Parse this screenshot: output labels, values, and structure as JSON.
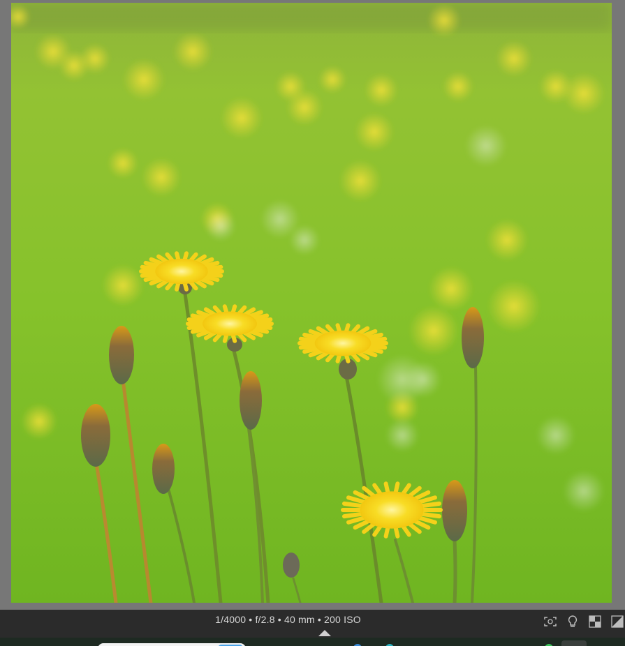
{
  "photo": {
    "subject": "yellow-dandelion-flowers-in-green-meadow"
  },
  "info_bar": {
    "exif": "1/4000 • f/2.8 • 40 mm • 200 ISO"
  },
  "toolbar": {
    "icons": [
      "focus-frame-icon",
      "lightbulb-icon",
      "checkerboard-icon",
      "compare-icon"
    ]
  },
  "taskbar": {
    "icons": [
      "search-box",
      "app-icon-blue",
      "app-icon-teal",
      "app-icon-green",
      "app-icon-dark"
    ]
  },
  "colors": {
    "background": "#777777",
    "info_bar": "#2b2b2b",
    "info_text": "#d8d8d8",
    "meadow_green": "#7fc02a",
    "flower_yellow": "#f7d51c"
  }
}
